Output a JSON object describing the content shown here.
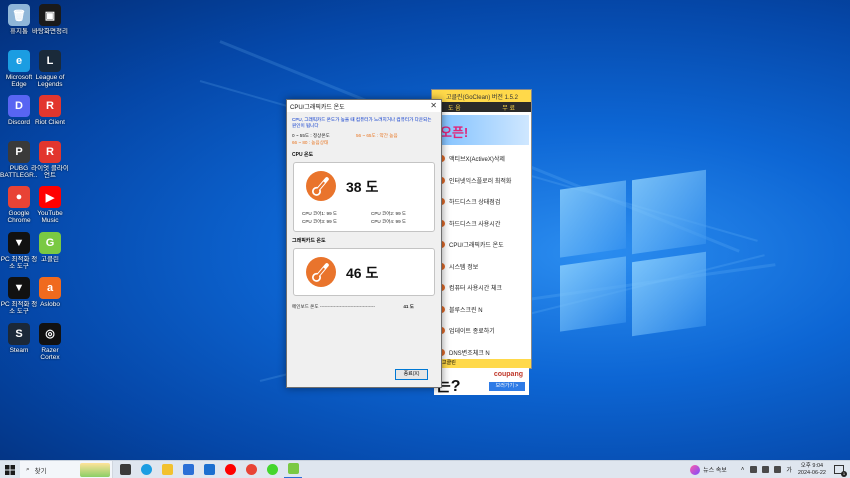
{
  "desktop": {
    "icons": [
      {
        "label": "휴지통",
        "color": "#8fb6d8",
        "glyph": "🗑"
      },
      {
        "label": "바탕화면정리",
        "color": "#1a1a1a",
        "glyph": "▣"
      },
      {
        "label": "Microsoft Edge",
        "color": "#1b9de2",
        "glyph": "e"
      },
      {
        "label": "League of Legends",
        "color": "#1a2a3a",
        "glyph": "L"
      },
      {
        "label": "Discord",
        "color": "#5865f2",
        "glyph": "D"
      },
      {
        "label": "Riot Client",
        "color": "#e2362e",
        "glyph": "R"
      },
      {
        "label": "PUBG BATTLEGR...",
        "color": "#3a3a3a",
        "glyph": "P"
      },
      {
        "label": "라이엇 클라이언트",
        "color": "#e2362e",
        "glyph": "R"
      },
      {
        "label": "Google Chrome",
        "color": "#e84335",
        "glyph": "●"
      },
      {
        "label": "YouTube Music",
        "color": "#ff0000",
        "glyph": "▶"
      },
      {
        "label": "PC 최적화 청소 도구",
        "color": "#111111",
        "glyph": "▼"
      },
      {
        "label": "고클린",
        "color": "#7ac943",
        "glyph": "G"
      },
      {
        "label": "PC 최적화 청소 도구",
        "color": "#111111",
        "glyph": "▼"
      },
      {
        "label": "Aslobo",
        "color": "#f06a1e",
        "glyph": "a"
      },
      {
        "label": "Steam",
        "color": "#1b2838",
        "glyph": "S"
      },
      {
        "label": "Razer Cortex",
        "color": "#111111",
        "glyph": "◎"
      }
    ]
  },
  "bgapp": {
    "title": "고클린(GoClean) 버전 1.5.2",
    "menu": [
      "도 움",
      "무 료"
    ],
    "banner": "오픈!",
    "items": [
      "액티브X(ActiveX)삭제",
      "인터넷익스플로러 최적화",
      "하드디스크 상태점검",
      "하드디스크 사용시간",
      "CPU/그래픽카드 온도",
      "시스템 정보",
      "컴퓨터 사용시간 체크",
      "블루스크린 N",
      "업데이트   종료하기",
      "DNS변조체크 N"
    ],
    "ad_big": "는?",
    "ad_brand": "coupang",
    "ad_btn": "보러가기 >",
    "footer": "고클린"
  },
  "dialog": {
    "title": "CPU/그래픽카드 온도",
    "close": "✕",
    "description": "CPU, 그래픽카드 온도가 높을 때 컴퓨터가 느려지거나 컴퓨터가 다운되는 원인이 됩니다",
    "legend": {
      "row1_left": "0 ~ 55도 : 정상온도",
      "row1_right": "56 ~ 65도 : 약간 높음",
      "row2_left": "66 ~ 80 : 높음상태"
    },
    "cpu_label": "CPU 온도",
    "cpu_temp": "38 도",
    "cores": [
      "CPU 코어1: 99 도",
      "CPU 코어2: 99 도",
      "CPU 코어3: 99 도",
      "CPU 코어4: 99 도"
    ],
    "gpu_label": "그래픽카드 온도",
    "gpu_temp": "46 도",
    "mainboard_label": "메인보드 온도 ------------------------------------",
    "mainboard_value": "41 도",
    "ok_button": "종료(X)"
  },
  "taskbar": {
    "search_placeholder": "찾기",
    "apps": [
      {
        "name": "task-view",
        "color": "#3a3a3a"
      },
      {
        "name": "edge",
        "color": "#1b9de2"
      },
      {
        "name": "explorer",
        "color": "#f2c12e"
      },
      {
        "name": "store",
        "color": "#2a6fd6"
      },
      {
        "name": "mail",
        "color": "#1b6fd0"
      },
      {
        "name": "youtube-music",
        "color": "#ff0000"
      },
      {
        "name": "chrome",
        "color": "#e84335"
      },
      {
        "name": "razer",
        "color": "#44d62c"
      },
      {
        "name": "goclean",
        "color": "#7ac943"
      }
    ],
    "news": "뉴스 속보",
    "lang": "가",
    "time": "오후 9:04",
    "date": "2024-06-22",
    "notifications": "1"
  }
}
